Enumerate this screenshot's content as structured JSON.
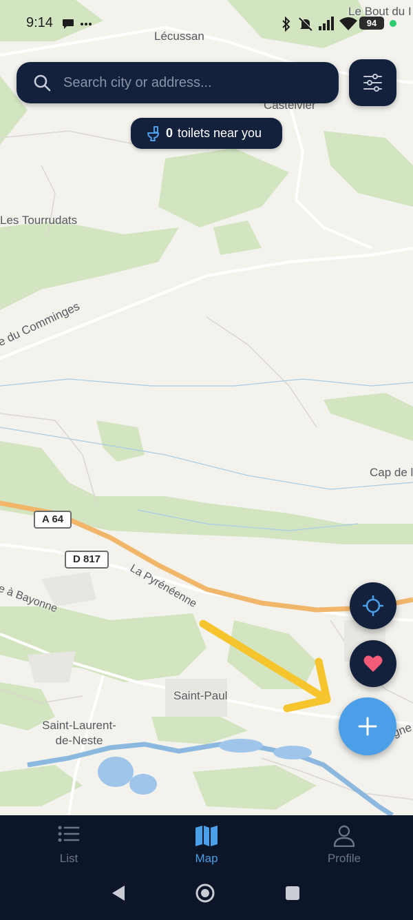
{
  "status_bar": {
    "time": "9:14",
    "battery": "94",
    "icons": [
      "chat-bubble-icon",
      "more-dots-icon",
      "bluetooth-icon",
      "muted-bell-icon",
      "signal-icon",
      "wifi-icon",
      "battery-icon"
    ]
  },
  "search": {
    "placeholder": "Search city or address..."
  },
  "filter_button": {
    "icon": "sliders-icon"
  },
  "toilets_pill": {
    "count": "0",
    "text": "toilets near you",
    "icon": "toilet-icon"
  },
  "map": {
    "places": [
      {
        "name": "Lécussan"
      },
      {
        "name": "Le Bout du I"
      },
      {
        "name": "Castelvier"
      },
      {
        "name": "Les Tourrudats"
      },
      {
        "name": "te du Comminges"
      },
      {
        "name": "Cap de l"
      },
      {
        "name": "La Pyrénéenne"
      },
      {
        "name": "e à Bayonne"
      },
      {
        "name": "Saint-Paul"
      },
      {
        "name": "Saint-Laurent-\nde-Neste"
      },
      {
        "name": "gne"
      }
    ],
    "road_badges": [
      "A 64",
      "D 817"
    ]
  },
  "fabs": {
    "locate_icon": "crosshair-icon",
    "favorites_icon": "heart-icon",
    "add_icon": "plus-icon"
  },
  "bottom_nav": {
    "items": [
      {
        "label": "List",
        "icon": "list-icon",
        "active": false
      },
      {
        "label": "Map",
        "icon": "map-icon",
        "active": true
      },
      {
        "label": "Profile",
        "icon": "profile-icon",
        "active": false
      }
    ]
  },
  "colors": {
    "navy": "#14213d",
    "accent_blue": "#4a9fe8",
    "heart": "#f25c78",
    "annotation_yellow": "#f6c42c",
    "map_green": "#cfe3bd",
    "map_bg": "#f3f2ec"
  }
}
